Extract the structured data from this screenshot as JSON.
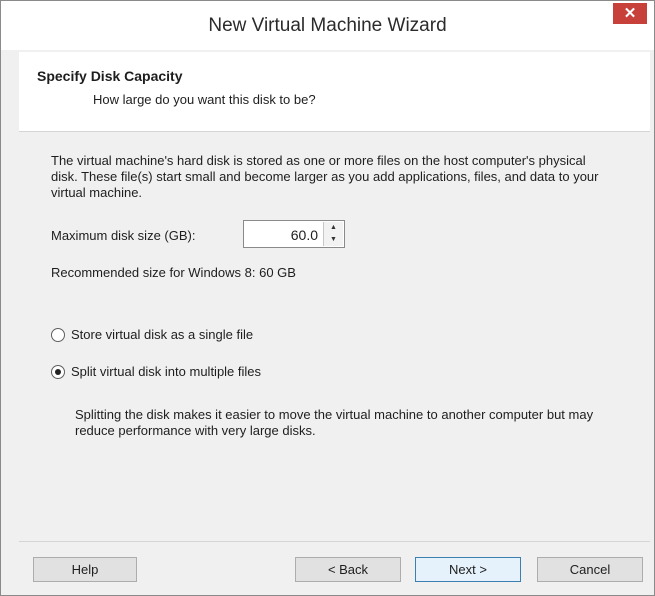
{
  "window": {
    "title": "New Virtual Machine Wizard",
    "close_glyph": "✕"
  },
  "header": {
    "title": "Specify Disk Capacity",
    "subtitle": "How large do you want this disk to be?"
  },
  "body": {
    "description": "The virtual machine's hard disk is stored as one or more files on the host computer's physical disk. These file(s) start small and become larger as you add applications, files, and data to your virtual machine.",
    "max_size_label": "Maximum disk size (GB):",
    "max_size_value": "60.0",
    "recommended": "Recommended size for Windows 8: 60 GB",
    "options": [
      {
        "label": "Store virtual disk as a single file",
        "checked": false
      },
      {
        "label": "Split virtual disk into multiple files",
        "checked": true
      }
    ],
    "split_description": "Splitting the disk makes it easier to move the virtual machine to another computer but may reduce performance with very large disks."
  },
  "buttons": {
    "help": "Help",
    "back": "< Back",
    "next": "Next >",
    "cancel": "Cancel"
  }
}
